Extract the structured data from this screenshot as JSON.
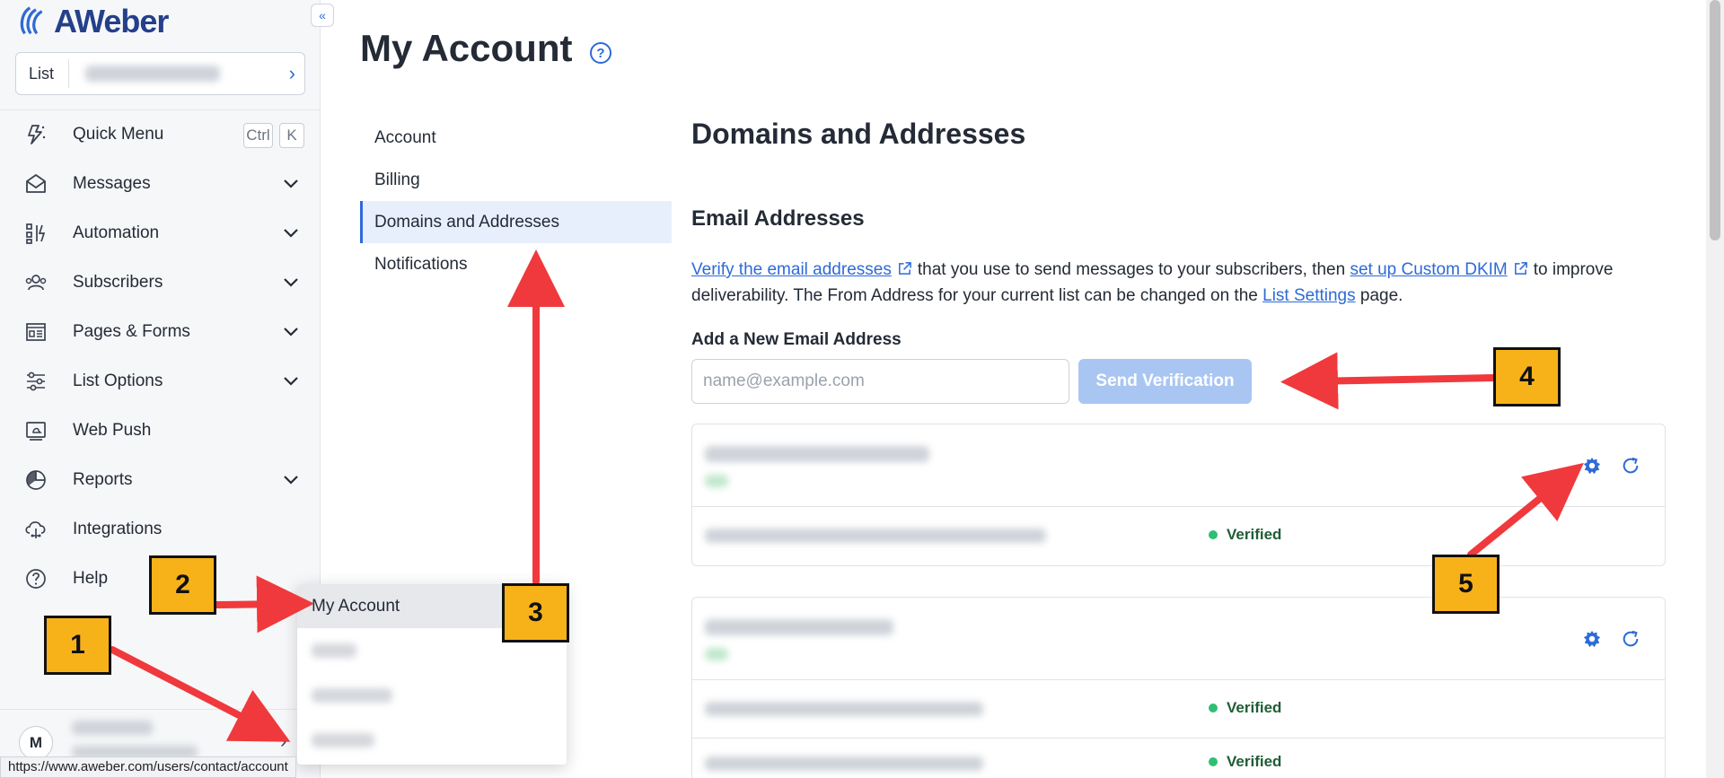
{
  "app": {
    "brand": "AWeber"
  },
  "sidebar": {
    "list_label": "List",
    "list_value": "",
    "items": [
      {
        "label": "Quick Menu",
        "icon": "quick-menu-icon",
        "shortcut": [
          "Ctrl",
          "K"
        ]
      },
      {
        "label": "Messages",
        "icon": "envelope-icon"
      },
      {
        "label": "Automation",
        "icon": "automation-icon"
      },
      {
        "label": "Subscribers",
        "icon": "subscribers-icon"
      },
      {
        "label": "Pages & Forms",
        "icon": "pages-forms-icon"
      },
      {
        "label": "List Options",
        "icon": "sliders-icon"
      },
      {
        "label": "Web Push",
        "icon": "web-push-icon"
      },
      {
        "label": "Reports",
        "icon": "pie-chart-icon"
      },
      {
        "label": "Integrations",
        "icon": "cloud-icon"
      },
      {
        "label": "Help",
        "icon": "help-icon"
      }
    ],
    "user": {
      "initial": "M"
    }
  },
  "popup_menu": {
    "items": [
      "My Account",
      "",
      "",
      ""
    ]
  },
  "status_bar": {
    "url": "https://www.aweber.com/users/contact/account"
  },
  "main": {
    "page_title": "My Account",
    "help_icon_glyph": "?",
    "subnav": [
      "Account",
      "Billing",
      "Domains and Addresses",
      "Notifications"
    ],
    "section_title": "Domains and Addresses",
    "email_section": {
      "title": "Email Addresses",
      "desc_link1": "Verify the email addresses",
      "desc_text1": "that you use to send messages to your subscribers, then",
      "desc_link2": "set up Custom DKIM",
      "desc_text2": "to improve deliverability. The From Address for your current list can be changed on the",
      "desc_link3": "List Settings",
      "desc_text3": "page.",
      "field_label": "Add a New Email Address",
      "input_placeholder": "name@example.com",
      "input_value": "",
      "button_label": "Send Verification"
    },
    "domains": [
      {
        "rows": [
          {
            "status": "Verified"
          }
        ]
      },
      {
        "rows": [
          {
            "status": "Verified"
          },
          {
            "status": "Verified"
          }
        ]
      }
    ]
  },
  "annotations": {
    "badges": [
      "1",
      "2",
      "3",
      "4",
      "5"
    ],
    "arrow_color": "#f0393c",
    "badge_color": "#f7b21a"
  }
}
